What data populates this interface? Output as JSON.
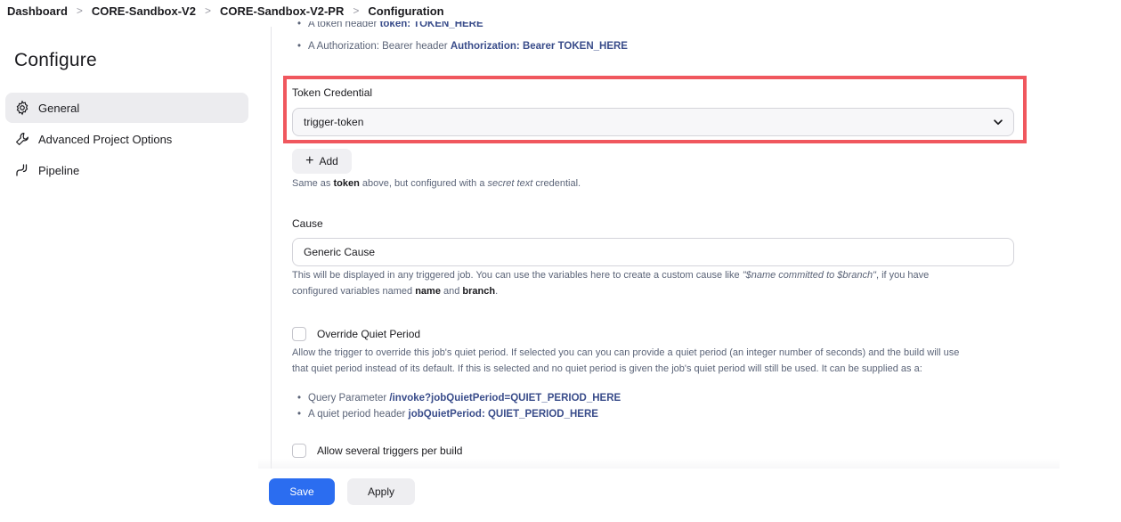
{
  "breadcrumb": [
    "Dashboard",
    "CORE-Sandbox-V2",
    "CORE-Sandbox-V2-PR",
    "Configuration"
  ],
  "sidebar": {
    "title": "Configure",
    "items": [
      {
        "label": "General",
        "icon": "gear-icon",
        "active": true
      },
      {
        "label": "Advanced Project Options",
        "icon": "wrench-icon",
        "active": false
      },
      {
        "label": "Pipeline",
        "icon": "pipeline-icon",
        "active": false
      }
    ]
  },
  "top_bullets": [
    {
      "text": "A token header ",
      "code": "token: TOKEN_HERE"
    },
    {
      "text": "A Authorization: Bearer header ",
      "code": "Authorization: Bearer TOKEN_HERE"
    }
  ],
  "token_credential": {
    "label": "Token Credential",
    "value": "trigger-token",
    "add_label": "Add",
    "help_pre": "Same as ",
    "help_bold": "token",
    "help_mid": " above, but configured with a ",
    "help_italic": "secret text",
    "help_post": " credential."
  },
  "cause": {
    "label": "Cause",
    "value": "Generic Cause",
    "help_pre": "This will be displayed in any triggered job. You can use the variables here to create a custom cause like ",
    "help_italic": "\"$name committed to $branch\"",
    "help_mid": ", if you have",
    "help_line2_pre": "configured variables named ",
    "help_bold1": "name",
    "help_and": " and ",
    "help_bold2": "branch",
    "help_end": "."
  },
  "quiet_period": {
    "label": "Override Quiet Period",
    "help_line1": "Allow the trigger to override this job's quiet period. If selected you can you can provide a quiet period (an integer number of seconds) and the build will use",
    "help_line2": "that quiet period instead of its default. If this is selected and no quiet period is given the job's quiet period will still be used. It can be supplied as a:",
    "bullets": [
      {
        "text": "Query Parameter ",
        "code": "/invoke?jobQuietPeriod=QUIET_PERIOD_HERE"
      },
      {
        "text": "A quiet period header ",
        "code": "jobQuietPeriod: QUIET_PERIOD_HERE"
      }
    ]
  },
  "several_triggers": {
    "label": "Allow several triggers per build"
  },
  "actions": {
    "save_label": "Save",
    "apply_label": "Apply"
  },
  "colors": {
    "accent": "#2b6df0",
    "highlight": "#f0575e",
    "code_text": "#394c8a"
  }
}
